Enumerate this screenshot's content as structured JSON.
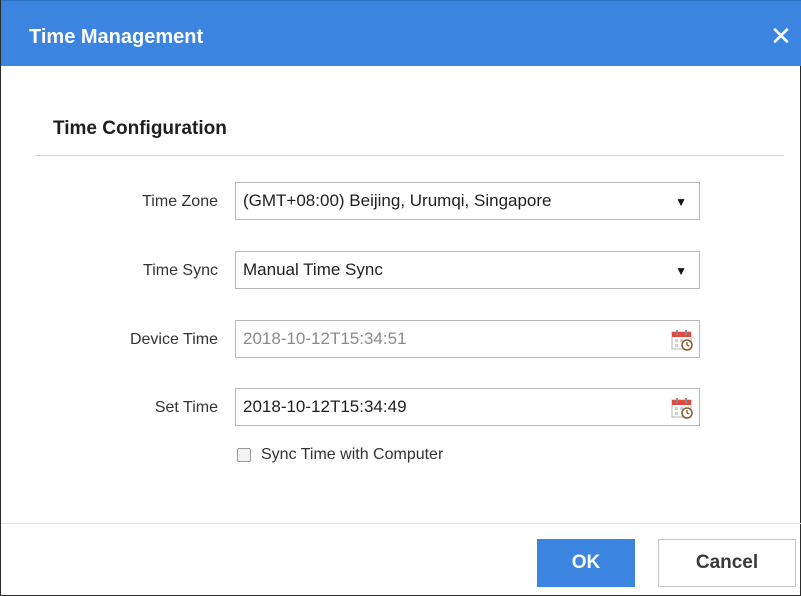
{
  "dialog": {
    "title": "Time Management",
    "close_glyph": "✕",
    "close_icon": "close-icon"
  },
  "section": {
    "title": "Time Configuration"
  },
  "fields": {
    "time_zone": {
      "label": "Time Zone",
      "value": "(GMT+08:00) Beijing, Urumqi, Singapore",
      "icon": "chevron-down-icon"
    },
    "time_sync": {
      "label": "Time Sync",
      "value": "Manual Time Sync",
      "icon": "chevron-down-icon"
    },
    "device_time": {
      "label": "Device Time",
      "value": "2018-10-12T15:34:51",
      "icon": "calendar-icon"
    },
    "set_time": {
      "label": "Set Time",
      "value": "2018-10-12T15:34:49",
      "icon": "calendar-icon"
    }
  },
  "sync_checkbox": {
    "label": "Sync Time with Computer",
    "checked": false
  },
  "footer": {
    "ok_label": "OK",
    "cancel_label": "Cancel"
  },
  "colors": {
    "accent": "#3b85e0",
    "calendar_red": "#e2483d"
  }
}
